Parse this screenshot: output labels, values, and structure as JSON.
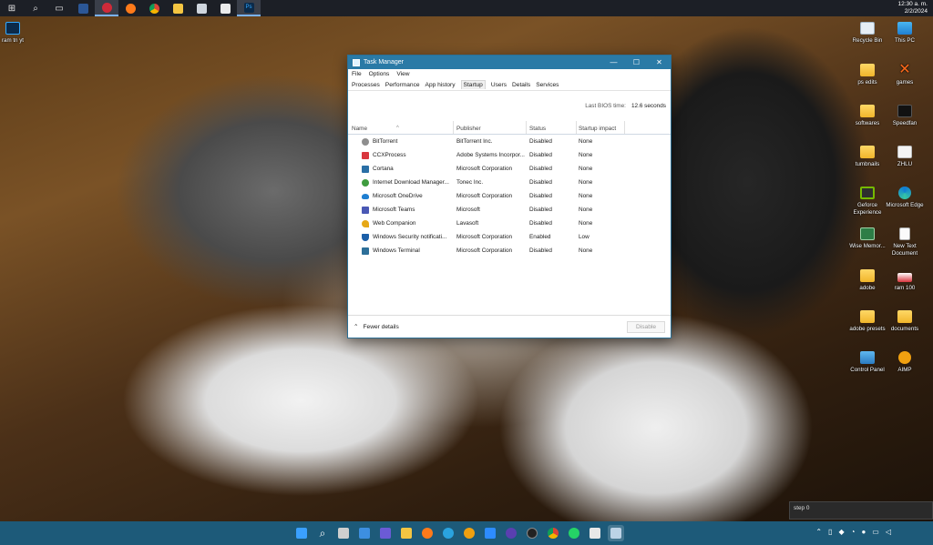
{
  "top_taskbar": {
    "icons": [
      {
        "name": "windows-start-icon",
        "glyph": "⊞"
      },
      {
        "name": "search-icon",
        "glyph": "⌕"
      },
      {
        "name": "task-view-icon",
        "glyph": "▭"
      },
      {
        "name": "word-icon",
        "color": "#2b5797"
      },
      {
        "name": "opera-icon",
        "color": "#d02a39"
      },
      {
        "name": "firefox-icon",
        "color": "#ff7a1a"
      },
      {
        "name": "chrome-icon",
        "color": "#e8b400"
      },
      {
        "name": "file-explorer-icon",
        "color": "#f4c542"
      },
      {
        "name": "printer-icon",
        "color": "#cfd6de"
      },
      {
        "name": "calendar-icon",
        "color": "#eaeaea"
      },
      {
        "name": "photoshop-icon",
        "color": "#0b2a4a",
        "label": "Ps"
      }
    ],
    "time": "12:30 a. m.",
    "date": "2/2/2024"
  },
  "desktop": {
    "left_icon": {
      "label": "ram tn yt",
      "color": "#0b2a4a"
    },
    "right_icons": [
      {
        "label": "Recycle Bin",
        "type": "recycle"
      },
      {
        "label": "This PC",
        "type": "pc"
      },
      {
        "label": "ps edits",
        "type": "folder"
      },
      {
        "label": "games",
        "type": "games"
      },
      {
        "label": "softwares",
        "type": "folder"
      },
      {
        "label": "Speedfan",
        "type": "speedfan"
      },
      {
        "label": "tumbnails",
        "type": "folder"
      },
      {
        "label": "ZHLU",
        "type": "doc"
      },
      {
        "label": "Geforce Experience",
        "type": "geforce"
      },
      {
        "label": "Microsoft Edge",
        "type": "edge"
      },
      {
        "label": "Wise Memor...",
        "type": "wise"
      },
      {
        "label": "New Text Document",
        "type": "text"
      },
      {
        "label": "adobe",
        "type": "folder"
      },
      {
        "label": "ram 100",
        "type": "ram"
      },
      {
        "label": "adobe presets",
        "type": "folder"
      },
      {
        "label": "documents",
        "type": "folder"
      },
      {
        "label": "Control Panel",
        "type": "control"
      },
      {
        "label": "AIMP",
        "type": "aimp"
      }
    ]
  },
  "task_manager": {
    "title": "Task Manager",
    "window_buttons": {
      "minimize": "—",
      "maximize": "☐",
      "close": "✕"
    },
    "menu": [
      "File",
      "Options",
      "View"
    ],
    "tabs": [
      "Processes",
      "Performance",
      "App history",
      "Startup",
      "Users",
      "Details",
      "Services"
    ],
    "active_tab": "Startup",
    "bios_label": "Last BIOS time:",
    "bios_value": "12.6 seconds",
    "columns": [
      "Name",
      "Publisher",
      "Status",
      "Startup impact"
    ],
    "rows": [
      {
        "name": "BitTorrent",
        "publisher": "BitTorrent Inc.",
        "status": "Disabled",
        "impact": "None",
        "color": "#8e8e8e"
      },
      {
        "name": "CCXProcess",
        "publisher": "Adobe Systems Incorpor...",
        "status": "Disabled",
        "impact": "None",
        "color": "#d9363e"
      },
      {
        "name": "Cortana",
        "publisher": "Microsoft Corporation",
        "status": "Disabled",
        "impact": "None",
        "color": "#2a6fa6"
      },
      {
        "name": "Internet Download Manager...",
        "publisher": "Tonec Inc.",
        "status": "Disabled",
        "impact": "None",
        "color": "#3f9c3f"
      },
      {
        "name": "Microsoft OneDrive",
        "publisher": "Microsoft Corporation",
        "status": "Disabled",
        "impact": "None",
        "color": "#1f7fd1"
      },
      {
        "name": "Microsoft Teams",
        "publisher": "Microsoft",
        "status": "Disabled",
        "impact": "None",
        "color": "#4a58b5"
      },
      {
        "name": "Web Companion",
        "publisher": "Lavasoft",
        "status": "Disabled",
        "impact": "None",
        "color": "#e6a817"
      },
      {
        "name": "Windows Security notificati...",
        "publisher": "Microsoft Corporation",
        "status": "Enabled",
        "impact": "Low",
        "color": "#1c5fa8"
      },
      {
        "name": "Windows Terminal",
        "publisher": "Microsoft Corporation",
        "status": "Disabled",
        "impact": "None",
        "color": "#2d6f99"
      }
    ],
    "fewer_details": "Fewer details",
    "disable_button": "Disable"
  },
  "tooltip": "step 0",
  "bottom_taskbar": {
    "icons": [
      {
        "name": "windows-start-icon",
        "color": "#3aa0ff"
      },
      {
        "name": "search-icon",
        "color": "#e0e0e0"
      },
      {
        "name": "task-view-icon",
        "color": "#cfcfcf"
      },
      {
        "name": "widgets-icon",
        "color": "#3d8fe0"
      },
      {
        "name": "teams-chat-icon",
        "color": "#6b5bd6"
      },
      {
        "name": "file-explorer-icon",
        "color": "#f4c542"
      },
      {
        "name": "firefox-icon",
        "color": "#ff7a1a"
      },
      {
        "name": "telegram-icon",
        "color": "#2aa3df"
      },
      {
        "name": "aimp-icon",
        "color": "#f0a010"
      },
      {
        "name": "zoom-icon",
        "color": "#2d8cff"
      },
      {
        "name": "vpn-icon",
        "color": "#5a3fb0"
      },
      {
        "name": "speedfan-icon",
        "color": "#222"
      },
      {
        "name": "chrome-icon",
        "color": "#e8b400"
      },
      {
        "name": "whatsapp-icon",
        "color": "#25d366"
      },
      {
        "name": "calendar-icon",
        "color": "#e8e8e8"
      },
      {
        "name": "task-manager-icon",
        "color": "#bcd3e6"
      }
    ],
    "tray_icons": [
      "chevron-up-icon",
      "tablet-icon",
      "dropbox-icon",
      "wifi-icon",
      "mic-icon",
      "monitor-icon",
      "volume-icon"
    ]
  }
}
